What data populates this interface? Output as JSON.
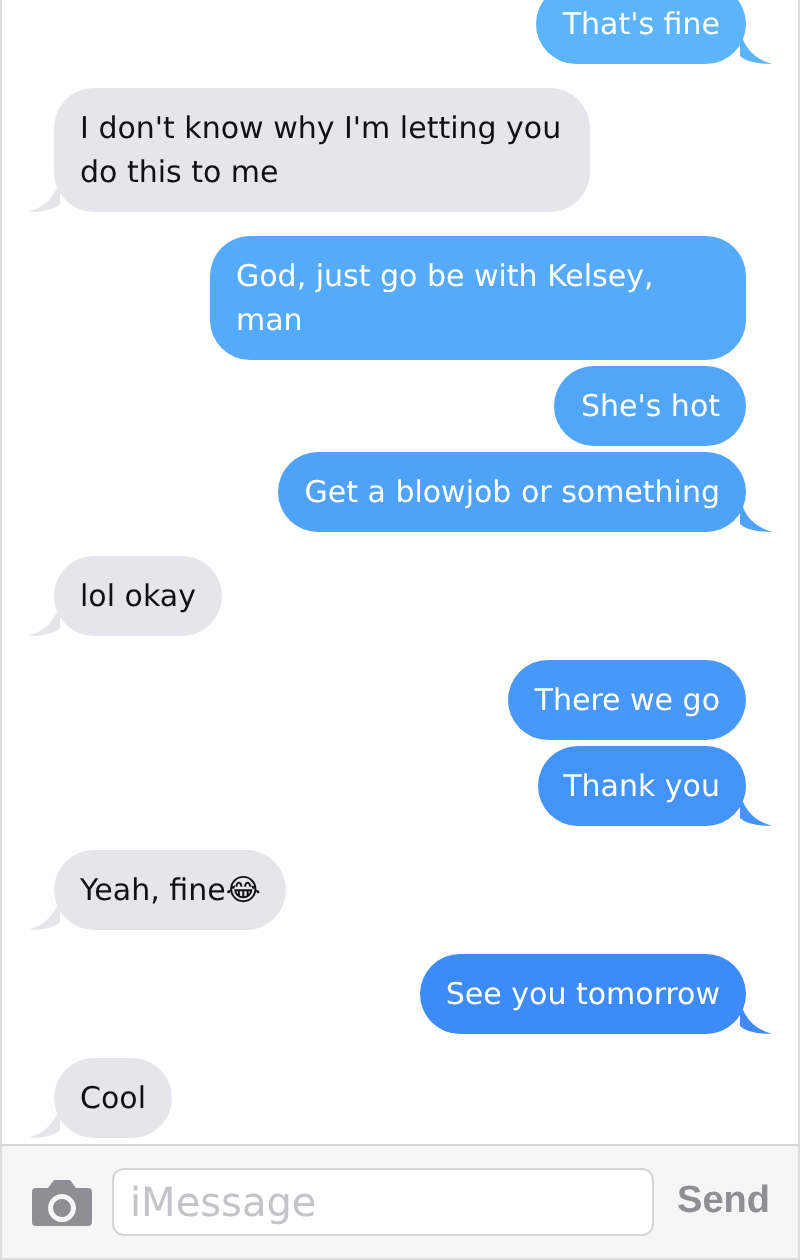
{
  "messages": [
    {
      "kind": "sent",
      "text": "That's fine"
    },
    {
      "kind": "received",
      "text": "I don't know why I'm letting you do this to me"
    },
    {
      "kind": "sent",
      "text": "God, just go be with Kelsey, man"
    },
    {
      "kind": "sent",
      "text": "She's hot"
    },
    {
      "kind": "sent",
      "text": "Get a blowjob or something"
    },
    {
      "kind": "received",
      "text": "lol okay"
    },
    {
      "kind": "sent",
      "text": "There we go"
    },
    {
      "kind": "sent",
      "text": "Thank you"
    },
    {
      "kind": "received",
      "text": "Yeah, fine😂"
    },
    {
      "kind": "sent",
      "text": "See you tomorrow"
    },
    {
      "kind": "received",
      "text": "Cool"
    }
  ],
  "input": {
    "placeholder": "iMessage"
  },
  "send_button": "Send"
}
